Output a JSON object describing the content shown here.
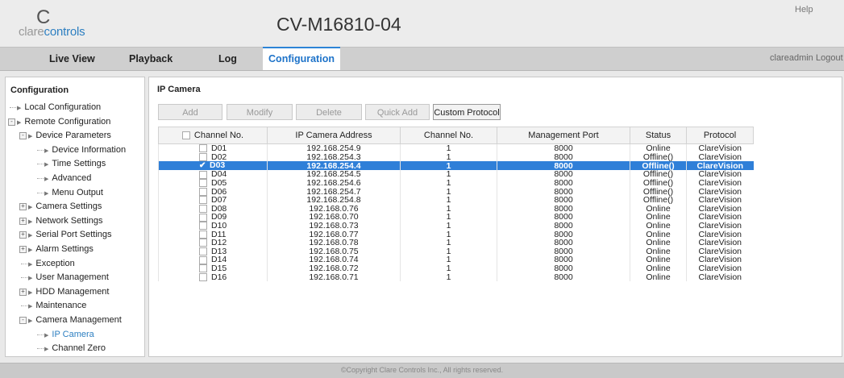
{
  "app": {
    "logo_c": "C",
    "logo_clare": "clare",
    "logo_controls": "controls",
    "device_name": "CV-M16810-04",
    "help": "Help",
    "user": "clareadmin",
    "logout": "Logout",
    "copyright": "©Copyright Clare Controls Inc., All rights reserved."
  },
  "nav": {
    "tabs": [
      {
        "label": "Live View",
        "active": false
      },
      {
        "label": "Playback",
        "active": false
      },
      {
        "label": "Log",
        "active": false
      },
      {
        "label": "Configuration",
        "active": true
      }
    ]
  },
  "sidebar": {
    "title": "Configuration",
    "items": [
      {
        "label": "Local Configuration",
        "level": 1,
        "toggle": "",
        "active": false
      },
      {
        "label": "Remote Configuration",
        "level": 1,
        "toggle": "-",
        "active": false
      },
      {
        "label": "Device Parameters",
        "level": 2,
        "toggle": "-",
        "active": false
      },
      {
        "label": "Device Information",
        "level": 3,
        "toggle": "",
        "active": false
      },
      {
        "label": "Time Settings",
        "level": 3,
        "toggle": "",
        "active": false
      },
      {
        "label": "Advanced",
        "level": 3,
        "toggle": "",
        "active": false
      },
      {
        "label": "Menu Output",
        "level": 3,
        "toggle": "",
        "active": false
      },
      {
        "label": "Camera Settings",
        "level": 2,
        "toggle": "+",
        "active": false
      },
      {
        "label": "Network Settings",
        "level": 2,
        "toggle": "+",
        "active": false
      },
      {
        "label": "Serial Port Settings",
        "level": 2,
        "toggle": "+",
        "active": false
      },
      {
        "label": "Alarm Settings",
        "level": 2,
        "toggle": "+",
        "active": false
      },
      {
        "label": "Exception",
        "level": 2,
        "toggle": "",
        "active": false
      },
      {
        "label": "User Management",
        "level": 2,
        "toggle": "",
        "active": false
      },
      {
        "label": "HDD Management",
        "level": 2,
        "toggle": "+",
        "active": false
      },
      {
        "label": "Maintenance",
        "level": 2,
        "toggle": "",
        "active": false
      },
      {
        "label": "Camera Management",
        "level": 2,
        "toggle": "-",
        "active": false
      },
      {
        "label": "IP Camera",
        "level": 3,
        "toggle": "",
        "active": true
      },
      {
        "label": "Channel Zero",
        "level": 3,
        "toggle": "",
        "active": false
      }
    ]
  },
  "main": {
    "section_title": "IP Camera",
    "buttons": [
      {
        "label": "Add",
        "enabled": false
      },
      {
        "label": "Modify",
        "enabled": false
      },
      {
        "label": "Delete",
        "enabled": false
      },
      {
        "label": "Quick Add",
        "enabled": false
      },
      {
        "label": "Custom Protocol",
        "enabled": true
      }
    ],
    "columns": [
      "Channel No.",
      "IP Camera Address",
      "Channel No.",
      "Management Port",
      "Status",
      "Protocol"
    ],
    "rows": [
      {
        "ch": "D01",
        "ip": "192.168.254.9",
        "cam_ch": "1",
        "port": "8000",
        "status": "Online",
        "protocol": "ClareVision",
        "checked": false,
        "selected": false
      },
      {
        "ch": "D02",
        "ip": "192.168.254.3",
        "cam_ch": "1",
        "port": "8000",
        "status": "Offline()",
        "protocol": "ClareVision",
        "checked": false,
        "selected": false
      },
      {
        "ch": "D03",
        "ip": "192.168.254.4",
        "cam_ch": "1",
        "port": "8000",
        "status": "Offline()",
        "protocol": "ClareVision",
        "checked": true,
        "selected": true
      },
      {
        "ch": "D04",
        "ip": "192.168.254.5",
        "cam_ch": "1",
        "port": "8000",
        "status": "Offline()",
        "protocol": "ClareVision",
        "checked": false,
        "selected": false
      },
      {
        "ch": "D05",
        "ip": "192.168.254.6",
        "cam_ch": "1",
        "port": "8000",
        "status": "Offline()",
        "protocol": "ClareVision",
        "checked": false,
        "selected": false
      },
      {
        "ch": "D06",
        "ip": "192.168.254.7",
        "cam_ch": "1",
        "port": "8000",
        "status": "Offline()",
        "protocol": "ClareVision",
        "checked": false,
        "selected": false
      },
      {
        "ch": "D07",
        "ip": "192.168.254.8",
        "cam_ch": "1",
        "port": "8000",
        "status": "Offline()",
        "protocol": "ClareVision",
        "checked": false,
        "selected": false
      },
      {
        "ch": "D08",
        "ip": "192.168.0.76",
        "cam_ch": "1",
        "port": "8000",
        "status": "Online",
        "protocol": "ClareVision",
        "checked": false,
        "selected": false
      },
      {
        "ch": "D09",
        "ip": "192.168.0.70",
        "cam_ch": "1",
        "port": "8000",
        "status": "Online",
        "protocol": "ClareVision",
        "checked": false,
        "selected": false
      },
      {
        "ch": "D10",
        "ip": "192.168.0.73",
        "cam_ch": "1",
        "port": "8000",
        "status": "Online",
        "protocol": "ClareVision",
        "checked": false,
        "selected": false
      },
      {
        "ch": "D11",
        "ip": "192.168.0.77",
        "cam_ch": "1",
        "port": "8000",
        "status": "Online",
        "protocol": "ClareVision",
        "checked": false,
        "selected": false
      },
      {
        "ch": "D12",
        "ip": "192.168.0.78",
        "cam_ch": "1",
        "port": "8000",
        "status": "Online",
        "protocol": "ClareVision",
        "checked": false,
        "selected": false
      },
      {
        "ch": "D13",
        "ip": "192.168.0.75",
        "cam_ch": "1",
        "port": "8000",
        "status": "Online",
        "protocol": "ClareVision",
        "checked": false,
        "selected": false
      },
      {
        "ch": "D14",
        "ip": "192.168.0.74",
        "cam_ch": "1",
        "port": "8000",
        "status": "Online",
        "protocol": "ClareVision",
        "checked": false,
        "selected": false
      },
      {
        "ch": "D15",
        "ip": "192.168.0.72",
        "cam_ch": "1",
        "port": "8000",
        "status": "Online",
        "protocol": "ClareVision",
        "checked": false,
        "selected": false
      },
      {
        "ch": "D16",
        "ip": "192.168.0.71",
        "cam_ch": "1",
        "port": "8000",
        "status": "Online",
        "protocol": "ClareVision",
        "checked": false,
        "selected": false
      }
    ]
  },
  "icons": {
    "tree_arrow": "triangle-right-icon",
    "checkbox": "checkbox-icon",
    "checkmark": "checkmark-icon"
  },
  "colors": {
    "accent": "#2d7fc1",
    "selected_row": "#2f7fd8"
  }
}
